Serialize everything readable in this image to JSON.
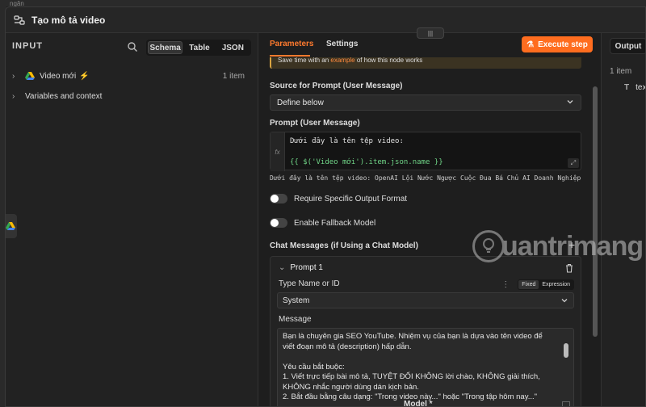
{
  "window": {
    "title": "Tạo mô tả video",
    "bg_tab_text": "ngăn"
  },
  "input": {
    "heading": "INPUT",
    "tabs": [
      {
        "label": "Schema",
        "active": true
      },
      {
        "label": "Table",
        "active": false
      },
      {
        "label": "JSON",
        "active": false
      }
    ],
    "nodes": [
      {
        "label": "Video mới",
        "count": "1 item"
      },
      {
        "label": "Variables and context"
      }
    ]
  },
  "params": {
    "handle": "|||",
    "tabs": {
      "parameters": "Parameters",
      "settings": "Settings"
    },
    "execute_label": "Execute step",
    "notice": {
      "prefix": "Save time with an",
      "link": "example",
      "suffix": "of how this node works"
    },
    "source_label": "Source for Prompt (User Message)",
    "source_value": "Define below",
    "prompt_label": "Prompt (User Message)",
    "prompt_fx": "fx",
    "prompt_line1": "Dưới đây là tên tệp video:",
    "prompt_line2": "{{ $('Video mới').item.json.name }}",
    "prompt_preview": "Dưới đây là tên tệp video: OpenAI Lội Nước Ngược Cuộc Đua Bá Chủ AI Doanh Nghiệp ...",
    "toggle_output_format": "Require Specific Output Format",
    "toggle_fallback": "Enable Fallback Model",
    "chat_messages_label": "Chat Messages (if Using a Chat Model)",
    "prompt1_label": "Prompt 1",
    "type_label": "Type Name or ID",
    "mode_fixed": "Fixed",
    "mode_expression": "Expression",
    "type_value": "System",
    "message_label": "Message",
    "message_lines": [
      "Bạn là chuyên gia SEO YouTube. Nhiệm vụ của bạn là dựa vào tên video để",
      "viết đoạn mô tả (description) hấp dẫn.",
      "",
      "Yêu cầu bắt buộc:",
      "1. Viết trực tiếp bài mô tả, TUYỆT ĐỐI KHÔNG lời chào, KHÔNG giải thích,",
      "KHÔNG nhắc người dùng dán kịch bản.",
      "2. Bắt đầu bằng câu dạng: \"Trong video này...\" hoặc \"Trong tập hôm nay...\""
    ],
    "footer_label": "Model *"
  },
  "output": {
    "tab_label": "Output",
    "count": "1 item",
    "field_type": "T",
    "field_name": "text"
  },
  "watermark": {
    "text": "uantrimang"
  },
  "colors": {
    "accent": "#ff6d1f",
    "expression_green": "#6fd386"
  }
}
